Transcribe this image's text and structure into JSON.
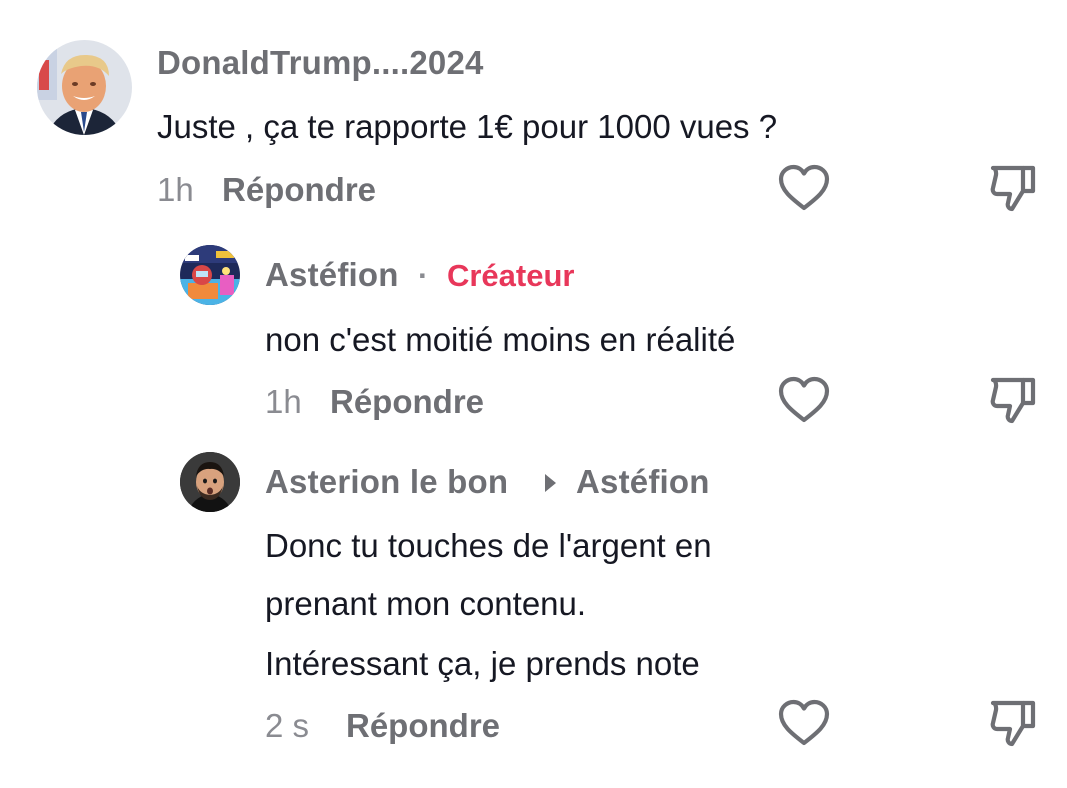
{
  "comments": [
    {
      "username": "DonaldTrump....2024",
      "text": "Juste , ça te rapporte 1€ pour 1000 vues ?",
      "time": "1h",
      "reply_label": "Répondre"
    },
    {
      "username": "Astéfion",
      "separator": "·",
      "badge": "Créateur",
      "text": "non c'est moitié moins en réalité",
      "time": "1h",
      "reply_label": "Répondre"
    },
    {
      "username": "Asterion le bon",
      "reply_to": "Astéfion",
      "text_lines": [
        "Donc tu touches de l'argent en",
        "prenant mon contenu.",
        "Intéressant ça, je prends note"
      ],
      "time": "2 s",
      "reply_label": "Répondre"
    }
  ],
  "icons": {
    "like": "heart-outline-icon",
    "dislike": "thumbs-down-outline-icon"
  },
  "colors": {
    "creator_badge": "#e8375a",
    "username": "#6e6f74",
    "text": "#161823",
    "meta": "#8a8b91"
  }
}
